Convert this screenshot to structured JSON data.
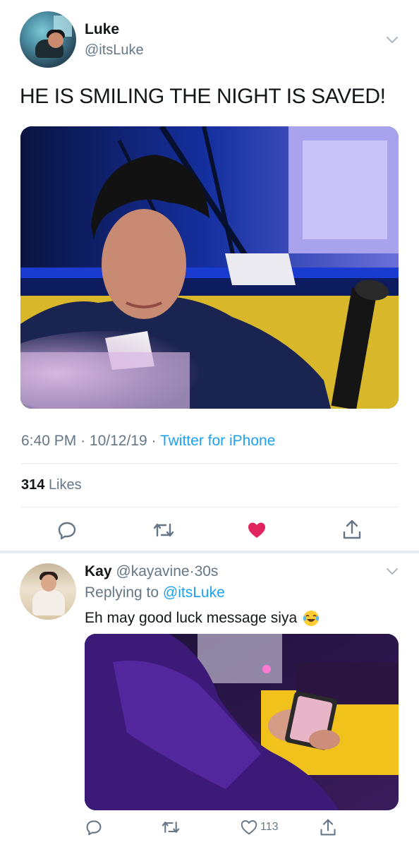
{
  "tweet": {
    "author_name": "Luke",
    "author_handle": "@itsLuke",
    "text": "HE IS SMILING THE NIGHT IS SAVED!",
    "time": "6:40 PM",
    "date": "10/12/19",
    "separator": "·",
    "source": "Twitter for iPhone",
    "likes_count": "314",
    "likes_label": "Likes",
    "liked": true,
    "actions": [
      "reply-icon",
      "retweet-icon",
      "like-icon",
      "share-icon"
    ]
  },
  "reply": {
    "author_name": "Kay",
    "author_handle": "@kayavine",
    "separator": "·",
    "age": "30s",
    "replying_prefix": "Replying to",
    "replying_to": "@itsLuke",
    "text": "Eh may good luck message siya",
    "emoji": "face-with-tears-of-joy",
    "like_count": "113",
    "actions": [
      "reply-icon",
      "retweet-icon",
      "like-icon",
      "share-icon"
    ]
  },
  "colors": {
    "link": "#1da1f2",
    "muted": "#657786",
    "text": "#14171a",
    "like_active": "#e0245e",
    "divider": "#e6ecf0"
  }
}
